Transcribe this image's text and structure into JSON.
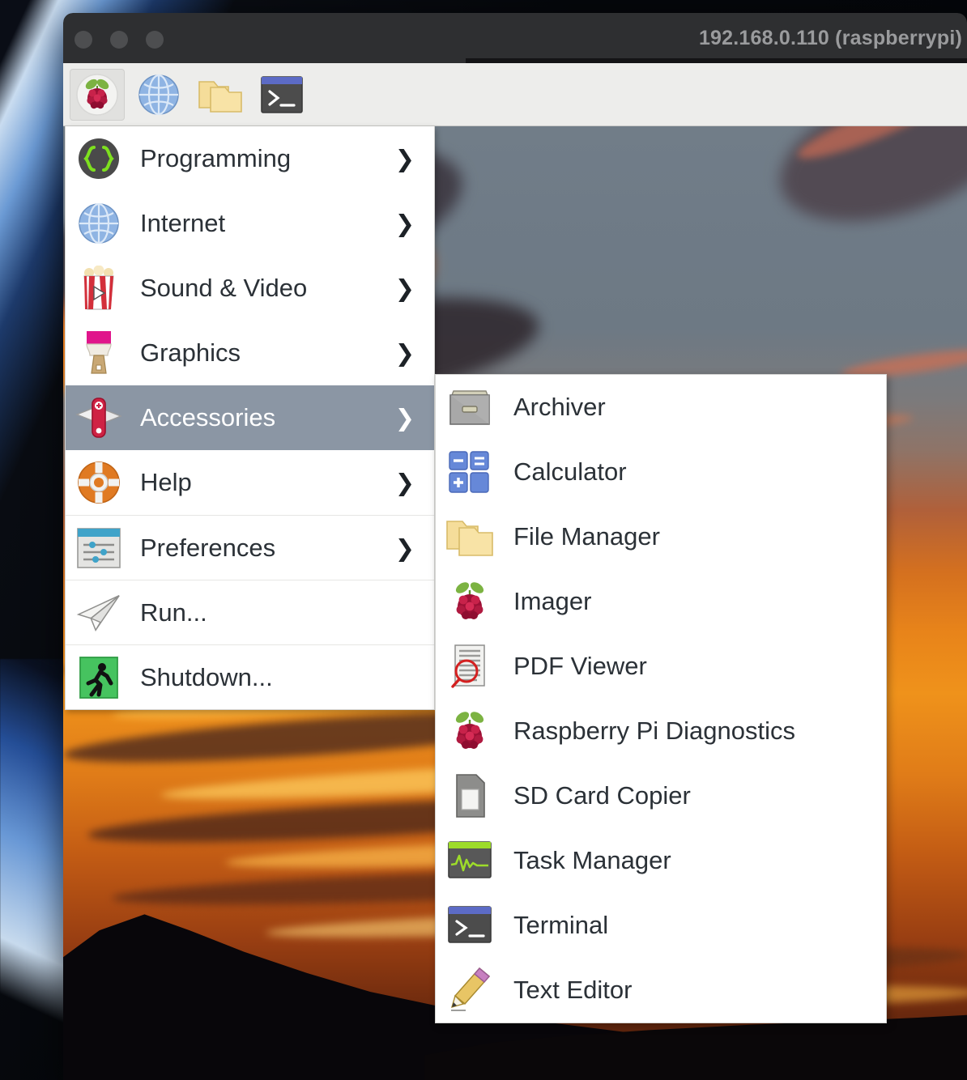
{
  "window": {
    "title": "192.168.0.110 (raspberrypi)",
    "traffic_lights": [
      "close-button",
      "minimize-button",
      "zoom-button"
    ]
  },
  "panel": {
    "buttons": [
      {
        "name": "raspberry-menu-button",
        "icon": "raspberry-pi-icon",
        "active": true
      },
      {
        "name": "web-browser-button",
        "icon": "globe-icon",
        "active": false
      },
      {
        "name": "file-manager-button",
        "icon": "folders-icon",
        "active": false
      },
      {
        "name": "terminal-button",
        "icon": "terminal-icon",
        "active": false
      }
    ]
  },
  "main_menu": {
    "items": [
      {
        "label": "Programming",
        "icon": "code-braces-icon",
        "arrow": "❯",
        "selected": false,
        "separator": false
      },
      {
        "label": "Internet",
        "icon": "globe-icon",
        "arrow": "❯",
        "selected": false,
        "separator": false
      },
      {
        "label": "Sound & Video",
        "icon": "popcorn-icon",
        "arrow": "❯",
        "selected": false,
        "separator": false
      },
      {
        "label": "Graphics",
        "icon": "paintbrush-icon",
        "arrow": "❯",
        "selected": false,
        "separator": false
      },
      {
        "label": "Accessories",
        "icon": "swiss-knife-icon",
        "arrow": "❯",
        "selected": true,
        "separator": false
      },
      {
        "label": "Help",
        "icon": "lifebuoy-icon",
        "arrow": "❯",
        "selected": false,
        "separator": false
      },
      {
        "label": "Preferences",
        "icon": "sliders-icon",
        "arrow": "❯",
        "selected": false,
        "separator": true
      },
      {
        "label": "Run...",
        "icon": "paper-plane-icon",
        "arrow": "",
        "selected": false,
        "separator": true
      },
      {
        "label": "Shutdown...",
        "icon": "exit-running-icon",
        "arrow": "",
        "selected": false,
        "separator": true
      }
    ]
  },
  "sub_menu": {
    "parent": "Accessories",
    "items": [
      {
        "label": "Archiver",
        "icon": "archive-box-icon"
      },
      {
        "label": "Calculator",
        "icon": "calculator-icon"
      },
      {
        "label": "File Manager",
        "icon": "folders-icon"
      },
      {
        "label": "Imager",
        "icon": "raspberry-pi-icon"
      },
      {
        "label": "PDF Viewer",
        "icon": "pdf-magnifier-icon"
      },
      {
        "label": "Raspberry Pi Diagnostics",
        "icon": "raspberry-pi-icon"
      },
      {
        "label": "SD Card Copier",
        "icon": "sd-card-icon"
      },
      {
        "label": "Task Manager",
        "icon": "task-monitor-icon"
      },
      {
        "label": "Terminal",
        "icon": "terminal-icon"
      },
      {
        "label": "Text Editor",
        "icon": "pencil-icon"
      }
    ]
  },
  "colors": {
    "titlebar": "#2e2f31",
    "title_text": "#9a9b9d",
    "panel_bg": "#ededeb",
    "menu_bg": "#ffffff",
    "menu_text": "#2b3137",
    "selection_bg": "#8b96a4",
    "selection_text": "#ffffff",
    "wallpaper_sky": "#6f7b87",
    "wallpaper_sunset": "#ef921b"
  }
}
